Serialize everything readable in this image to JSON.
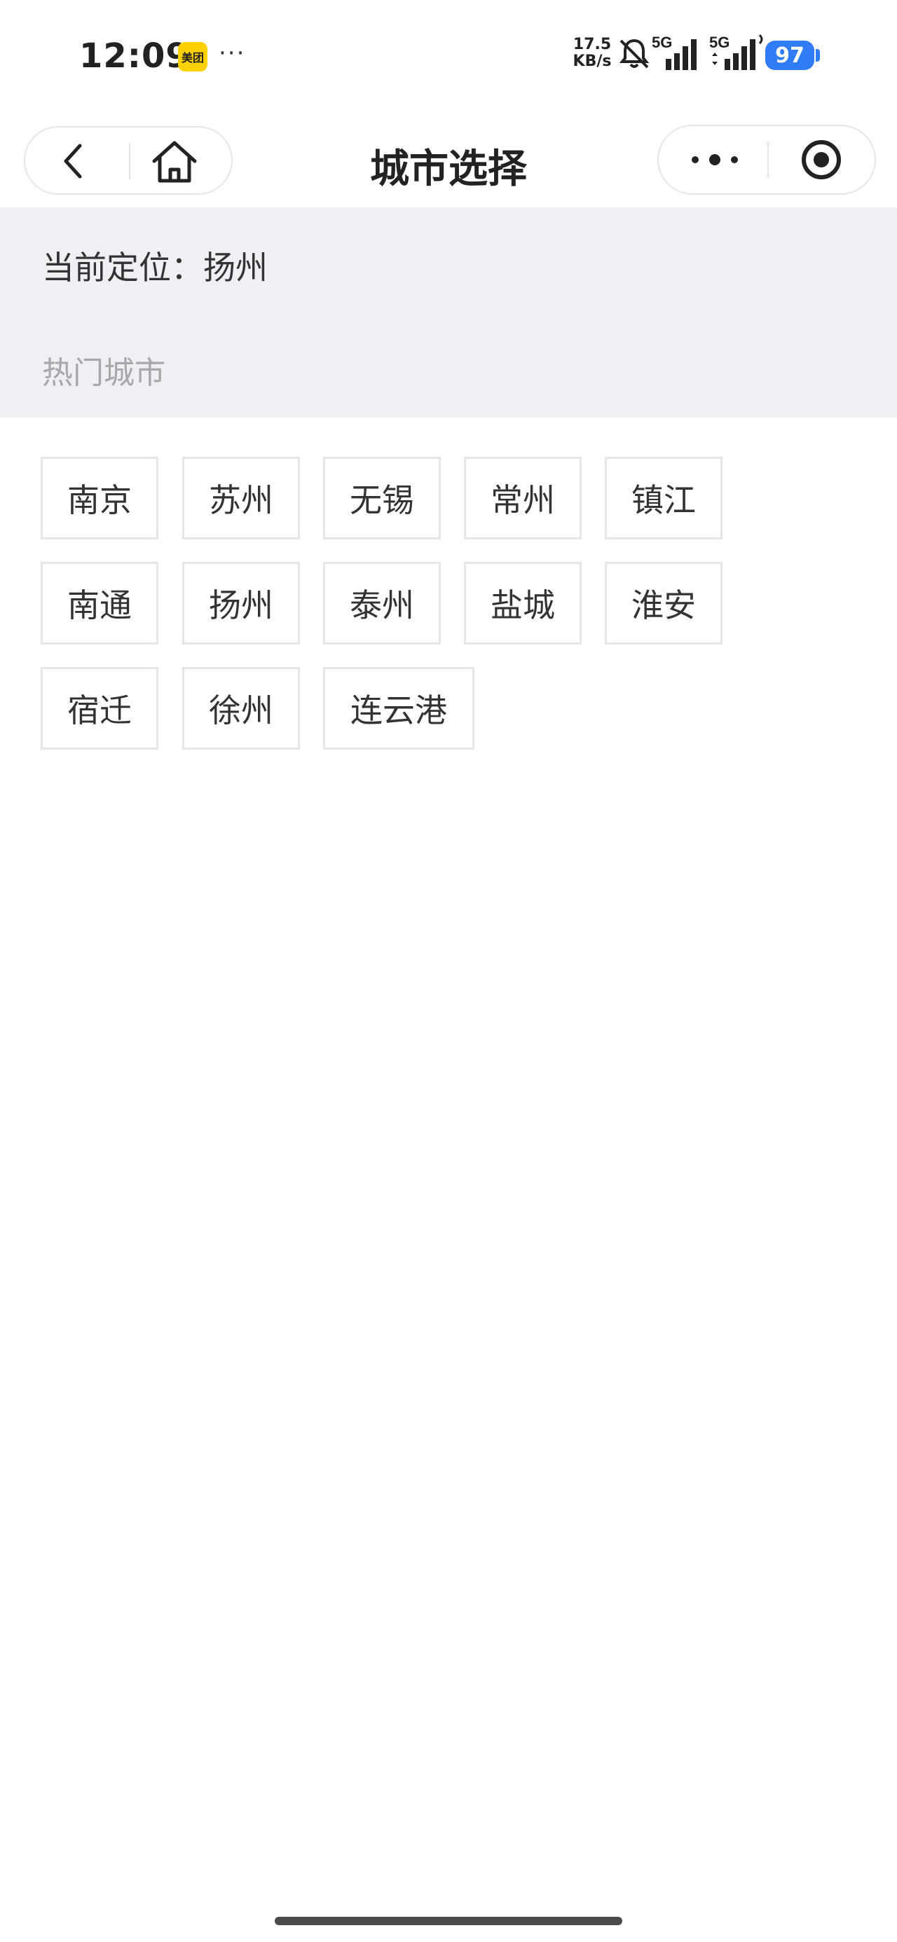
{
  "status_bar": {
    "time": "12:09",
    "app_badge": "美团",
    "more": "···",
    "net_speed_value": "17.5",
    "net_speed_unit": "KB/s",
    "signal1_label": "5G",
    "signal2_label": "5G",
    "battery": "97",
    "battery_color": "#2f7cf6"
  },
  "nav": {
    "title": "城市选择"
  },
  "location": {
    "current": "当前定位：扬州"
  },
  "hot": {
    "title": "热门城市",
    "cities": [
      "南京",
      "苏州",
      "无锡",
      "常州",
      "镇江",
      "南通",
      "扬州",
      "泰州",
      "盐城",
      "淮安",
      "宿迁",
      "徐州",
      "连云港"
    ]
  }
}
